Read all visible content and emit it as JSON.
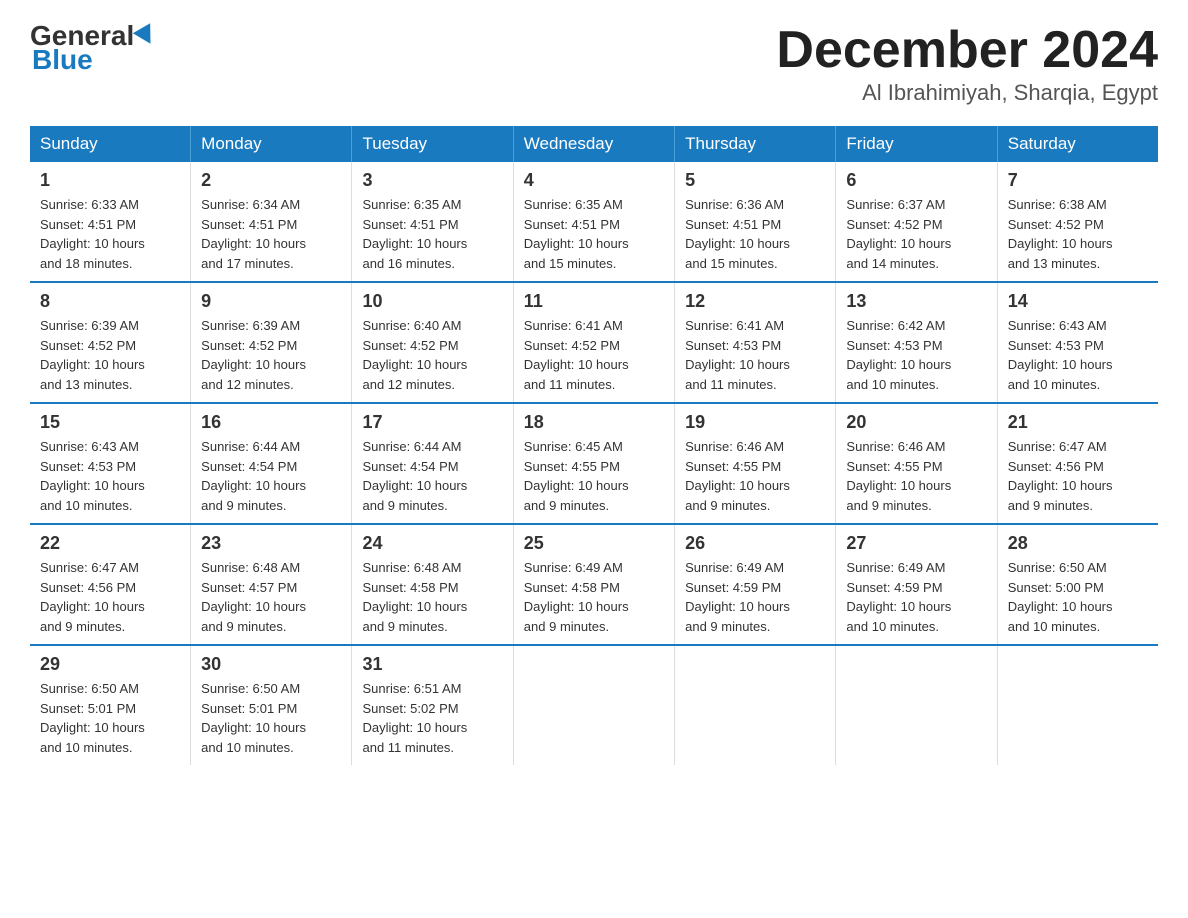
{
  "header": {
    "logo_general": "General",
    "logo_blue": "Blue",
    "month_title": "December 2024",
    "location": "Al Ibrahimiyah, Sharqia, Egypt"
  },
  "days_of_week": [
    "Sunday",
    "Monday",
    "Tuesday",
    "Wednesday",
    "Thursday",
    "Friday",
    "Saturday"
  ],
  "weeks": [
    [
      {
        "day": "1",
        "sunrise": "6:33 AM",
        "sunset": "4:51 PM",
        "daylight": "10 hours and 18 minutes."
      },
      {
        "day": "2",
        "sunrise": "6:34 AM",
        "sunset": "4:51 PM",
        "daylight": "10 hours and 17 minutes."
      },
      {
        "day": "3",
        "sunrise": "6:35 AM",
        "sunset": "4:51 PM",
        "daylight": "10 hours and 16 minutes."
      },
      {
        "day": "4",
        "sunrise": "6:35 AM",
        "sunset": "4:51 PM",
        "daylight": "10 hours and 15 minutes."
      },
      {
        "day": "5",
        "sunrise": "6:36 AM",
        "sunset": "4:51 PM",
        "daylight": "10 hours and 15 minutes."
      },
      {
        "day": "6",
        "sunrise": "6:37 AM",
        "sunset": "4:52 PM",
        "daylight": "10 hours and 14 minutes."
      },
      {
        "day": "7",
        "sunrise": "6:38 AM",
        "sunset": "4:52 PM",
        "daylight": "10 hours and 13 minutes."
      }
    ],
    [
      {
        "day": "8",
        "sunrise": "6:39 AM",
        "sunset": "4:52 PM",
        "daylight": "10 hours and 13 minutes."
      },
      {
        "day": "9",
        "sunrise": "6:39 AM",
        "sunset": "4:52 PM",
        "daylight": "10 hours and 12 minutes."
      },
      {
        "day": "10",
        "sunrise": "6:40 AM",
        "sunset": "4:52 PM",
        "daylight": "10 hours and 12 minutes."
      },
      {
        "day": "11",
        "sunrise": "6:41 AM",
        "sunset": "4:52 PM",
        "daylight": "10 hours and 11 minutes."
      },
      {
        "day": "12",
        "sunrise": "6:41 AM",
        "sunset": "4:53 PM",
        "daylight": "10 hours and 11 minutes."
      },
      {
        "day": "13",
        "sunrise": "6:42 AM",
        "sunset": "4:53 PM",
        "daylight": "10 hours and 10 minutes."
      },
      {
        "day": "14",
        "sunrise": "6:43 AM",
        "sunset": "4:53 PM",
        "daylight": "10 hours and 10 minutes."
      }
    ],
    [
      {
        "day": "15",
        "sunrise": "6:43 AM",
        "sunset": "4:53 PM",
        "daylight": "10 hours and 10 minutes."
      },
      {
        "day": "16",
        "sunrise": "6:44 AM",
        "sunset": "4:54 PM",
        "daylight": "10 hours and 9 minutes."
      },
      {
        "day": "17",
        "sunrise": "6:44 AM",
        "sunset": "4:54 PM",
        "daylight": "10 hours and 9 minutes."
      },
      {
        "day": "18",
        "sunrise": "6:45 AM",
        "sunset": "4:55 PM",
        "daylight": "10 hours and 9 minutes."
      },
      {
        "day": "19",
        "sunrise": "6:46 AM",
        "sunset": "4:55 PM",
        "daylight": "10 hours and 9 minutes."
      },
      {
        "day": "20",
        "sunrise": "6:46 AM",
        "sunset": "4:55 PM",
        "daylight": "10 hours and 9 minutes."
      },
      {
        "day": "21",
        "sunrise": "6:47 AM",
        "sunset": "4:56 PM",
        "daylight": "10 hours and 9 minutes."
      }
    ],
    [
      {
        "day": "22",
        "sunrise": "6:47 AM",
        "sunset": "4:56 PM",
        "daylight": "10 hours and 9 minutes."
      },
      {
        "day": "23",
        "sunrise": "6:48 AM",
        "sunset": "4:57 PM",
        "daylight": "10 hours and 9 minutes."
      },
      {
        "day": "24",
        "sunrise": "6:48 AM",
        "sunset": "4:58 PM",
        "daylight": "10 hours and 9 minutes."
      },
      {
        "day": "25",
        "sunrise": "6:49 AM",
        "sunset": "4:58 PM",
        "daylight": "10 hours and 9 minutes."
      },
      {
        "day": "26",
        "sunrise": "6:49 AM",
        "sunset": "4:59 PM",
        "daylight": "10 hours and 9 minutes."
      },
      {
        "day": "27",
        "sunrise": "6:49 AM",
        "sunset": "4:59 PM",
        "daylight": "10 hours and 10 minutes."
      },
      {
        "day": "28",
        "sunrise": "6:50 AM",
        "sunset": "5:00 PM",
        "daylight": "10 hours and 10 minutes."
      }
    ],
    [
      {
        "day": "29",
        "sunrise": "6:50 AM",
        "sunset": "5:01 PM",
        "daylight": "10 hours and 10 minutes."
      },
      {
        "day": "30",
        "sunrise": "6:50 AM",
        "sunset": "5:01 PM",
        "daylight": "10 hours and 10 minutes."
      },
      {
        "day": "31",
        "sunrise": "6:51 AM",
        "sunset": "5:02 PM",
        "daylight": "10 hours and 11 minutes."
      },
      null,
      null,
      null,
      null
    ]
  ],
  "labels": {
    "sunrise": "Sunrise:",
    "sunset": "Sunset:",
    "daylight": "Daylight:"
  }
}
